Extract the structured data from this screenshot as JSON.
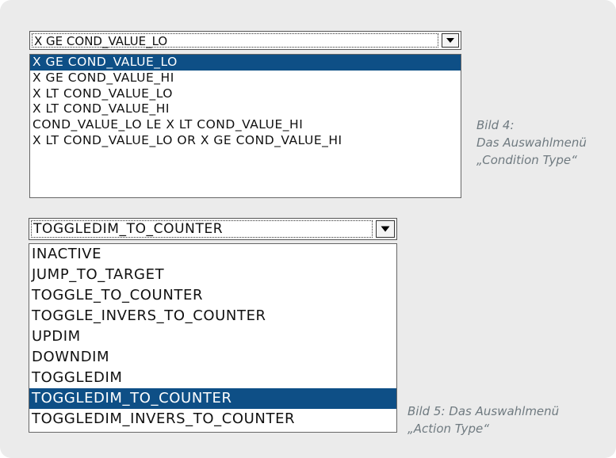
{
  "condition_dropdown": {
    "selected_value": "X GE COND_VALUE_LO",
    "options": [
      "X GE COND_VALUE_LO",
      "X GE COND_VALUE_HI",
      "X LT COND_VALUE_LO",
      "X LT COND_VALUE_HI",
      "COND_VALUE_LO LE X LT COND_VALUE_HI",
      "X LT COND_VALUE_LO OR X GE COND_VALUE_HI"
    ],
    "highlighted_index": 0
  },
  "action_dropdown": {
    "selected_value": "TOGGLEDIM_TO_COUNTER",
    "options": [
      "INACTIVE",
      "JUMP_TO_TARGET",
      "TOGGLE_TO_COUNTER",
      "TOGGLE_INVERS_TO_COUNTER",
      "UPDIM",
      "DOWNDIM",
      "TOGGLEDIM",
      "TOGGLEDIM_TO_COUNTER",
      "TOGGLEDIM_INVERS_TO_COUNTER"
    ],
    "highlighted_index": 7
  },
  "caption_condition": {
    "line1": "Bild 4:",
    "line2": "Das Auswahlmenü",
    "line3": "„Condition Type“"
  },
  "caption_action": {
    "line1": "Bild 5: Das Auswahlmenü",
    "line2": "„Action Type“"
  },
  "colors": {
    "panel_background": "#ebebeb",
    "selection_highlight": "#0e4f86",
    "caption_text": "#6f7a80"
  },
  "icons": {
    "dropdown_arrow": "chevron-down-icon"
  }
}
